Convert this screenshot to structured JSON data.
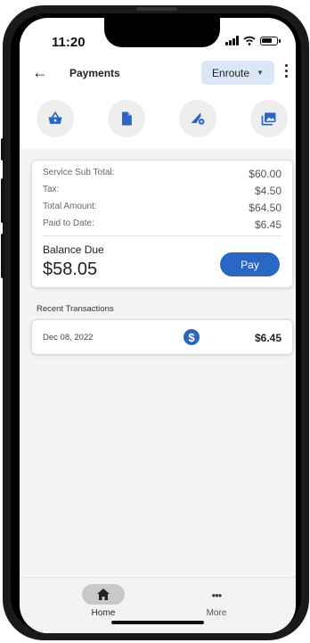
{
  "status_bar": {
    "time": "11:20"
  },
  "header": {
    "back_icon": "arrow-left-icon",
    "title": "Payments",
    "status_value": "Enroute",
    "menu_icon": "more-vertical-icon"
  },
  "quick_actions": [
    {
      "name": "basket-icon"
    },
    {
      "name": "document-icon"
    },
    {
      "name": "build-settings-icon"
    },
    {
      "name": "photos-icon"
    }
  ],
  "summary": {
    "rows": [
      {
        "label": "Service Sub Total:",
        "value": "$60.00"
      },
      {
        "label": "Tax:",
        "value": "$4.50"
      },
      {
        "label": "Total Amount:",
        "value": "$64.50"
      },
      {
        "label": "Paid to Date:",
        "value": "$6.45"
      }
    ],
    "balance_label": "Balance Due",
    "balance_amount": "$58.05",
    "pay_label": "Pay"
  },
  "recent": {
    "title": "Recent Transactions",
    "items": [
      {
        "date": "Dec 08, 2022",
        "icon": "dollar-icon",
        "amount": "$6.45"
      }
    ]
  },
  "bottom_nav": {
    "home_label": "Home",
    "more_label": "More"
  },
  "colors": {
    "accent": "#2a66c4",
    "status_chip": "#dbe6f7"
  }
}
